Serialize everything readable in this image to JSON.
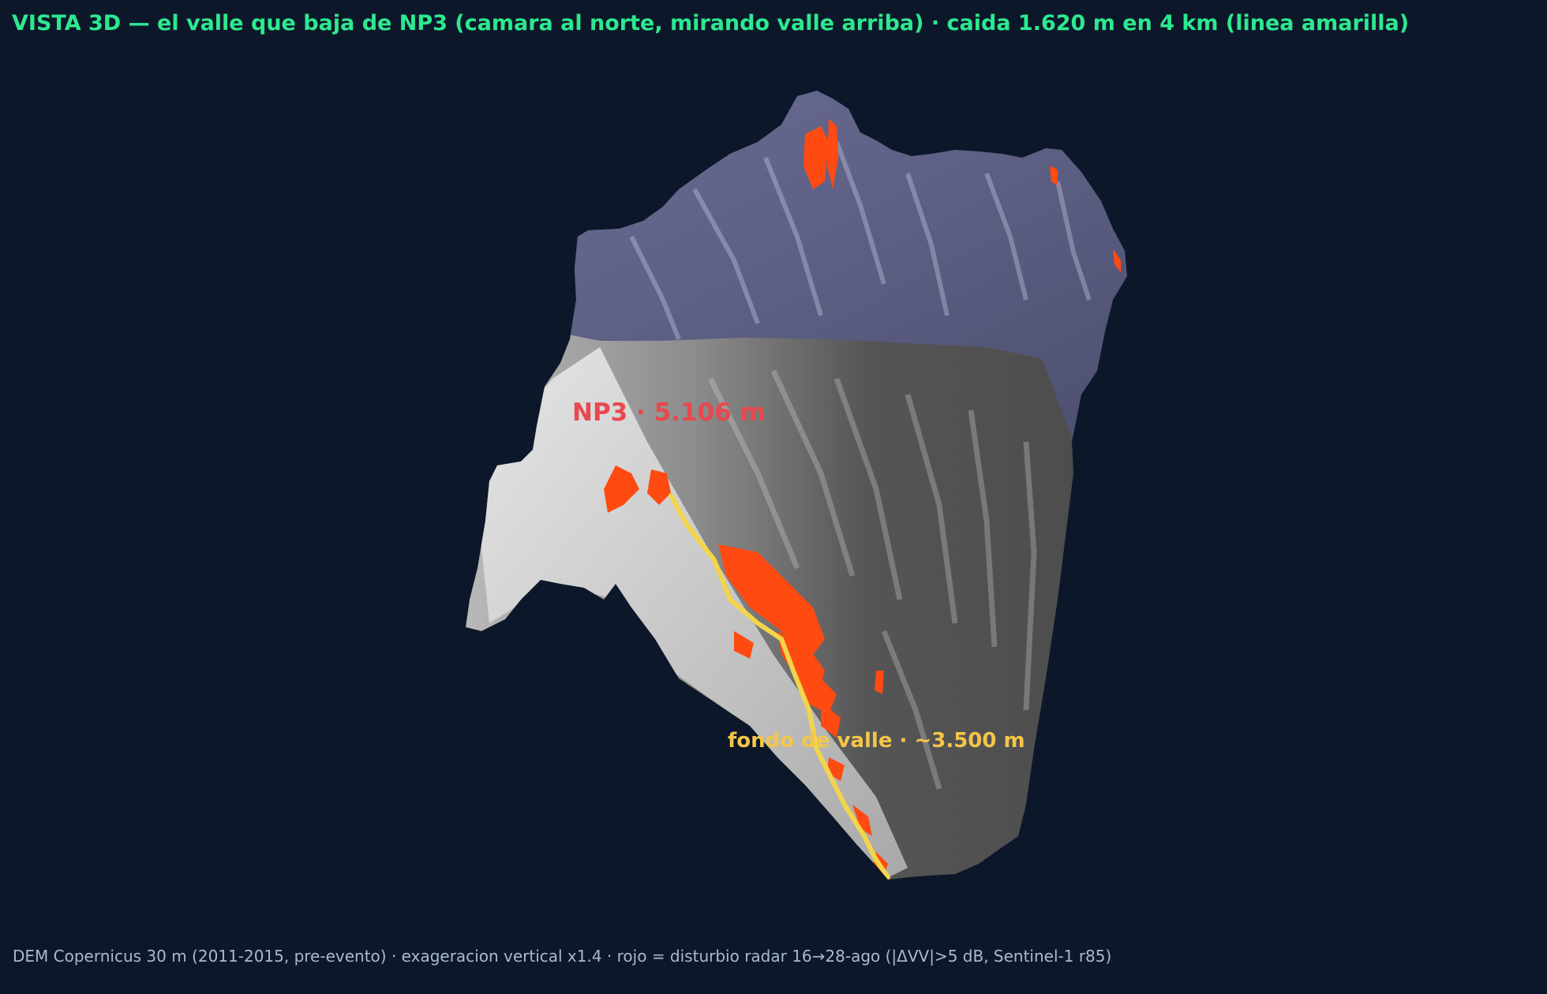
{
  "title": "VISTA 3D — el valle que baja de NP3 (camara al norte, mirando valle arriba) · caida 1.620 m en 4 km (linea amarilla)",
  "footer": "DEM Copernicus 30 m (2011-2015, pre-evento) · exageracion vertical x1.4 · rojo = disturbio radar 16→28-ago (|ΔVV|>5 dB, Sentinel-1 r85)",
  "labels": {
    "summit": "NP3 · 5.106 m",
    "valley_floor": "fondo de valle · ~3.500 m"
  },
  "colors": {
    "background": "#0c182a",
    "title": "#2ee88f",
    "footer": "#a9b9cf",
    "upper_terrain": "#5b5d82",
    "lower_terrain": "#4a4a4a",
    "slope_light": "#d9d9d9",
    "disturbance": "#ff4a12",
    "valley_line": "#f2d54a",
    "summit_label": "#e8484e",
    "valley_label": "#f4c548"
  }
}
